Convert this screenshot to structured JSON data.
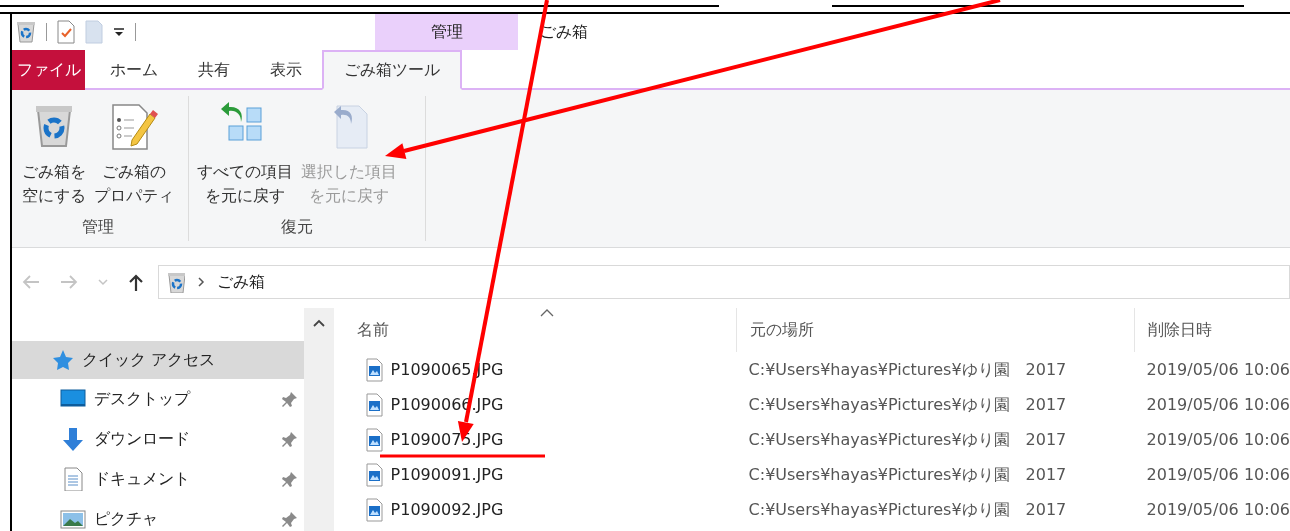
{
  "window": {
    "title": "ごみ箱"
  },
  "ribbon": {
    "context_group": "管理",
    "tabs": [
      {
        "label": "ファイル",
        "kind": "file",
        "selected": false
      },
      {
        "label": "ホーム",
        "kind": "tab",
        "selected": false
      },
      {
        "label": "共有",
        "kind": "tab",
        "selected": false
      },
      {
        "label": "表示",
        "kind": "tab",
        "selected": false
      },
      {
        "label": "ごみ箱ツール",
        "kind": "context",
        "selected": true
      }
    ],
    "groups": [
      {
        "label": "管理",
        "buttons": [
          {
            "kind": "empty",
            "lines": [
              "ごみ箱を",
              "空にする"
            ],
            "disabled": false
          },
          {
            "kind": "properties",
            "lines": [
              "ごみ箱の",
              "プロパティ"
            ],
            "disabled": false
          }
        ]
      },
      {
        "label": "復元",
        "buttons": [
          {
            "kind": "restore-all",
            "lines": [
              "すべての項目",
              "を元に戻す"
            ],
            "disabled": false
          },
          {
            "kind": "restore-selected",
            "lines": [
              "選択した項目",
              "を元に戻す"
            ],
            "disabled": true
          }
        ]
      }
    ]
  },
  "navigation": {
    "buttons": [
      {
        "kind": "back",
        "disabled": true
      },
      {
        "kind": "forward",
        "disabled": true
      },
      {
        "kind": "recent",
        "disabled": true
      },
      {
        "kind": "up",
        "disabled": false
      }
    ],
    "address": [
      "ごみ箱"
    ]
  },
  "sidebar": {
    "items": [
      {
        "label": "クイック アクセス",
        "selected": true,
        "children": [
          {
            "label": "デスクトップ",
            "kind": "desktop",
            "selected": false,
            "pinned": true
          },
          {
            "label": "ダウンロード",
            "kind": "download",
            "selected": false,
            "pinned": true
          },
          {
            "label": "ドキュメント",
            "kind": "documents",
            "selected": false,
            "pinned": true
          },
          {
            "label": "ピクチャ",
            "kind": "pictures",
            "selected": false,
            "pinned": true
          }
        ]
      }
    ]
  },
  "table": {
    "columns": [
      {
        "label": "名前",
        "sorted": true
      },
      {
        "label": "元の場所",
        "sorted": false
      },
      {
        "label": "削除日時",
        "sorted": false
      }
    ],
    "rows": [
      {
        "name": "P1090065.JPG",
        "location": "C:¥Users¥hayas¥Pictures¥ゆり園　2017",
        "deleted": "2019/05/06 10:06"
      },
      {
        "name": "P1090066.JPG",
        "location": "C:¥Users¥hayas¥Pictures¥ゆり園　2017",
        "deleted": "2019/05/06 10:06"
      },
      {
        "name": "P1090075.JPG",
        "location": "C:¥Users¥hayas¥Pictures¥ゆり園　2017",
        "deleted": "2019/05/06 10:06"
      },
      {
        "name": "P1090091.JPG",
        "location": "C:¥Users¥hayas¥Pictures¥ゆり園　2017",
        "deleted": "2019/05/06 10:06"
      },
      {
        "name": "P1090092.JPG",
        "location": "C:¥Users¥hayas¥Pictures¥ゆり園　2017",
        "deleted": "2019/05/06 10:06"
      }
    ]
  }
}
